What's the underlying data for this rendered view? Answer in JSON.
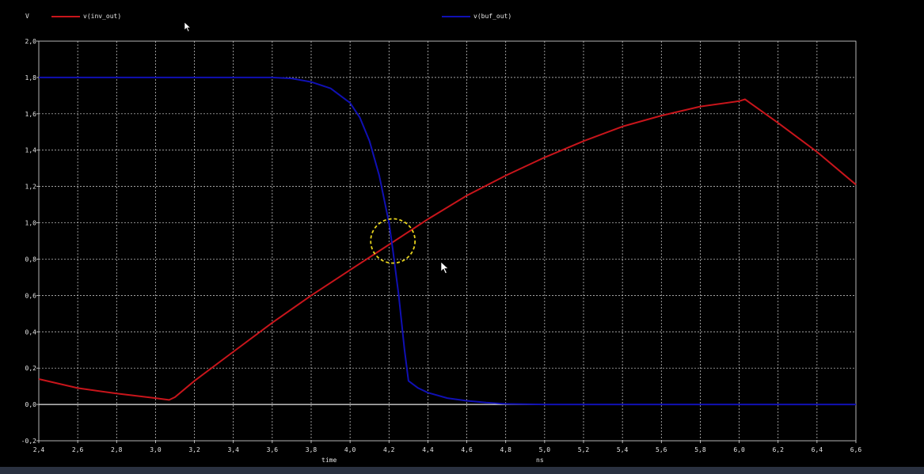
{
  "legend": {
    "unit": "V",
    "items": [
      {
        "label": "v(inv_out)",
        "color": "#c8151b"
      },
      {
        "label": "v(buf_out)",
        "color": "#1010b4"
      }
    ]
  },
  "axes": {
    "xlabel": "time",
    "xunit": "ns"
  },
  "chart_data": {
    "type": "line",
    "xlim": [
      2.4,
      6.6
    ],
    "ylim": [
      -0.2,
      2.0
    ],
    "xticks": [
      "2,4",
      "2,6",
      "2,8",
      "3,0",
      "3,2",
      "3,4",
      "3,6",
      "3,8",
      "4,0",
      "4,2",
      "4,4",
      "4,6",
      "4,8",
      "5,0",
      "5,2",
      "5,4",
      "5,6",
      "5,8",
      "6,0",
      "6,2",
      "6,4",
      "6,6"
    ],
    "yticks": [
      "-0,2",
      "0,0",
      "0,2",
      "0,4",
      "0,6",
      "0,8",
      "1,0",
      "1,2",
      "1,4",
      "1,6",
      "1,8",
      "2,0"
    ],
    "grid": true,
    "legend_position": "top",
    "series": [
      {
        "name": "v(inv_out)",
        "color": "#c8151b",
        "x": [
          2.4,
          2.6,
          2.8,
          3.0,
          3.07,
          3.1,
          3.2,
          3.4,
          3.6,
          3.8,
          4.0,
          4.2,
          4.4,
          4.6,
          4.8,
          5.0,
          5.2,
          5.4,
          5.6,
          5.8,
          6.0,
          6.03,
          6.2,
          6.4,
          6.6
        ],
        "y": [
          0.14,
          0.09,
          0.06,
          0.035,
          0.025,
          0.04,
          0.13,
          0.29,
          0.45,
          0.6,
          0.74,
          0.88,
          1.02,
          1.15,
          1.26,
          1.36,
          1.45,
          1.53,
          1.59,
          1.64,
          1.67,
          1.68,
          1.55,
          1.39,
          1.21
        ]
      },
      {
        "name": "v(buf_out)",
        "color": "#1010b4",
        "x": [
          2.4,
          3.6,
          3.7,
          3.8,
          3.9,
          4.0,
          4.05,
          4.1,
          4.15,
          4.2,
          4.22,
          4.25,
          4.28,
          4.3,
          4.35,
          4.4,
          4.5,
          4.6,
          4.7,
          4.8,
          5.0,
          6.6
        ],
        "y": [
          1.8,
          1.8,
          1.795,
          1.775,
          1.74,
          1.66,
          1.58,
          1.45,
          1.26,
          1.0,
          0.85,
          0.6,
          0.3,
          0.13,
          0.09,
          0.065,
          0.035,
          0.02,
          0.01,
          0.003,
          0.0,
          0.0
        ]
      }
    ],
    "reference_line": {
      "y": 0.0,
      "color": "#e8e8e8"
    },
    "annotations": [
      {
        "type": "circle",
        "x": 4.22,
        "y": 0.9,
        "color": "#e6d21c"
      }
    ]
  }
}
